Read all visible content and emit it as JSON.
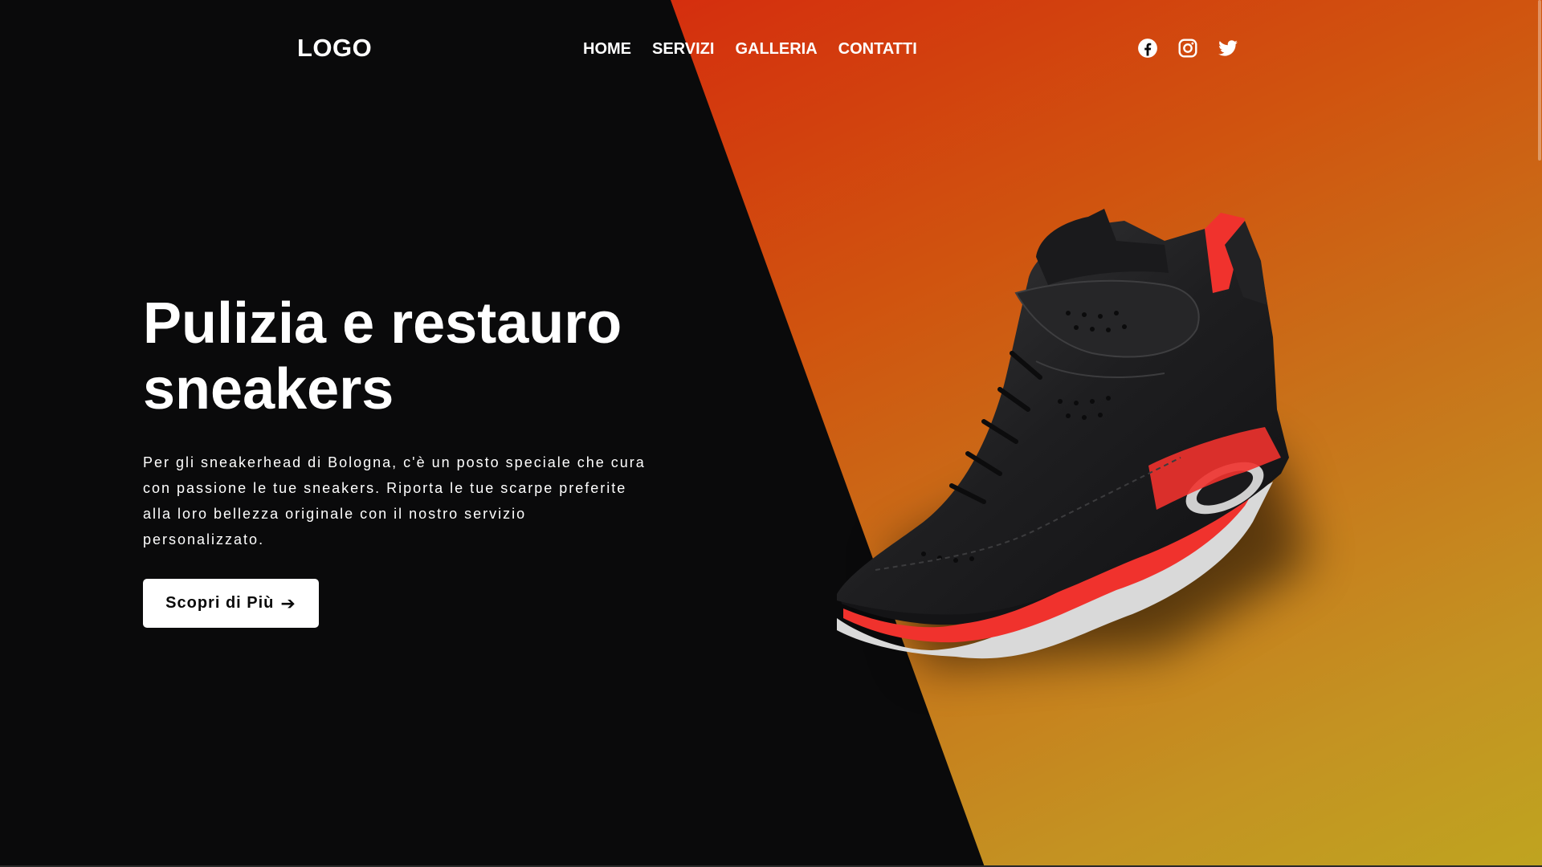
{
  "header": {
    "logo_text": "LOGO",
    "nav": [
      {
        "label": "HOME"
      },
      {
        "label": "SERVIZI"
      },
      {
        "label": "GALLERIA"
      },
      {
        "label": "CONTATTI"
      }
    ],
    "social": [
      {
        "icon": "facebook-icon"
      },
      {
        "icon": "instagram-icon"
      },
      {
        "icon": "twitter-icon"
      }
    ]
  },
  "hero": {
    "title": "Pulizia e restauro sneakers",
    "description": "Per gli sneakerhead di Bologna, c'è un posto speciale che cura con passione le tue sneakers. Riporta le tue scarpe preferite alla loro bellezza originale con il nostro servizio personalizzato.",
    "cta_label": "Scopri di Più",
    "cta_icon": "arrow-right-icon"
  },
  "colors": {
    "background": "#0a0a0b",
    "gradient_start": "#e10a08",
    "gradient_end": "#bfa420",
    "text": "#ffffff",
    "button_bg": "#ffffff",
    "shoe_accent": "#f0322d"
  }
}
